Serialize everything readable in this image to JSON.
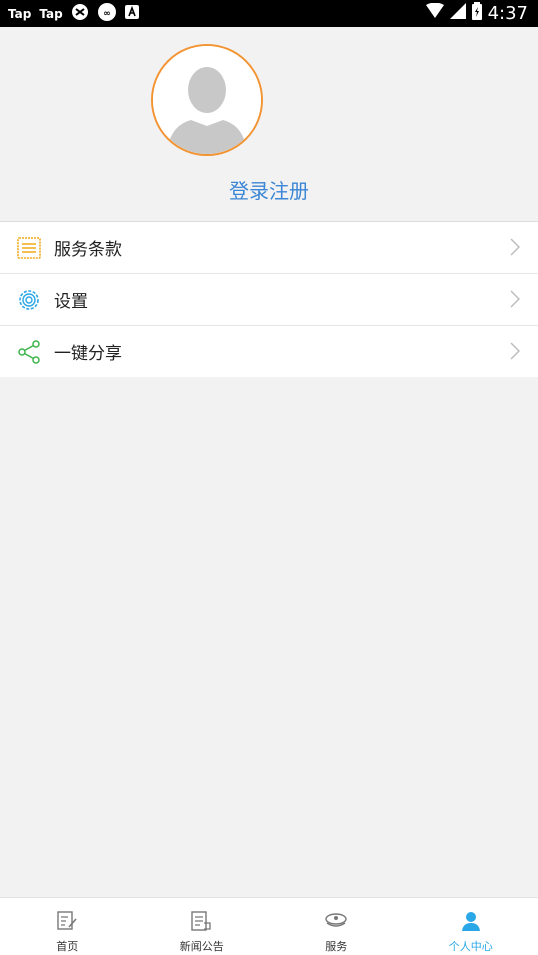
{
  "status_bar": {
    "left_items": [
      "Tap",
      "Tap"
    ],
    "time": "4:37"
  },
  "profile": {
    "login_label": "登录注册"
  },
  "menu": [
    {
      "label": "服务条款",
      "icon": "document-icon",
      "color": "#f0a818"
    },
    {
      "label": "设置",
      "icon": "gear-icon",
      "color": "#2aa7e6"
    },
    {
      "label": "一键分享",
      "icon": "share-icon",
      "color": "#3cb54a"
    }
  ],
  "tabs": [
    {
      "label": "首页",
      "icon": "home-edit-icon",
      "active": false
    },
    {
      "label": "新闻公告",
      "icon": "news-icon",
      "active": false
    },
    {
      "label": "服务",
      "icon": "service-hat-icon",
      "active": false
    },
    {
      "label": "个人中心",
      "icon": "person-icon",
      "active": true
    }
  ],
  "colors": {
    "accent": "#2aa7e6",
    "avatar_ring": "#f39433",
    "login_text": "#3b86d6"
  }
}
